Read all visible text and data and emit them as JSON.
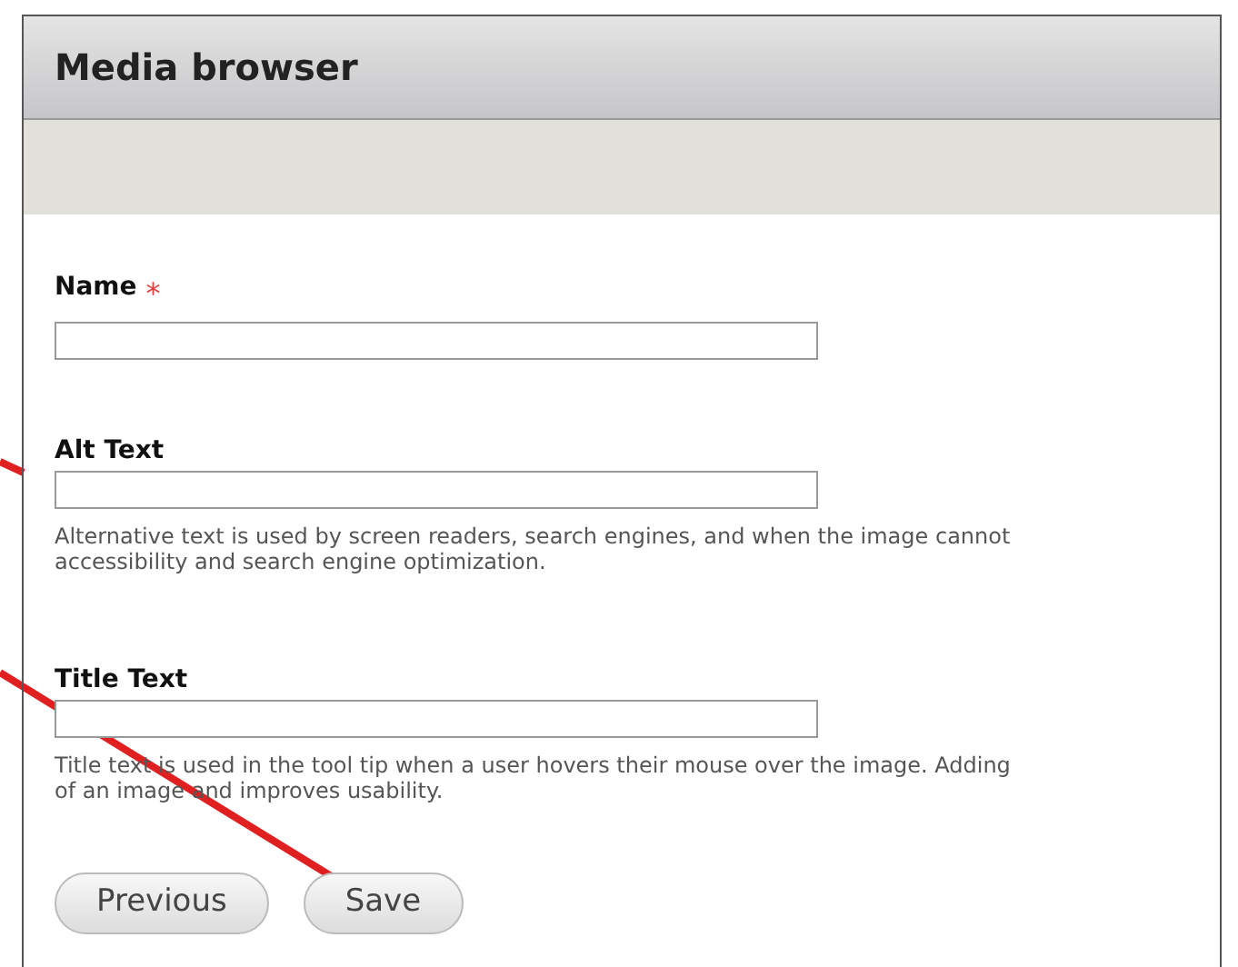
{
  "dialog": {
    "title": "Media browser"
  },
  "fields": [
    {
      "label": "Name",
      "required": true
    },
    {
      "label": "Alt Text",
      "required": false,
      "description_lines": [
        "Alternative text is used by screen readers, search engines, and when the image cannot",
        "accessibility and search engine optimization."
      ]
    },
    {
      "label": "Title Text",
      "required": false,
      "description_lines": [
        "Title text is used in the tool tip when a user hovers their mouse over the image. Adding",
        "of an image and improves usability."
      ]
    }
  ],
  "required_mark": "*",
  "buttons": [
    "Previous",
    "Save"
  ]
}
